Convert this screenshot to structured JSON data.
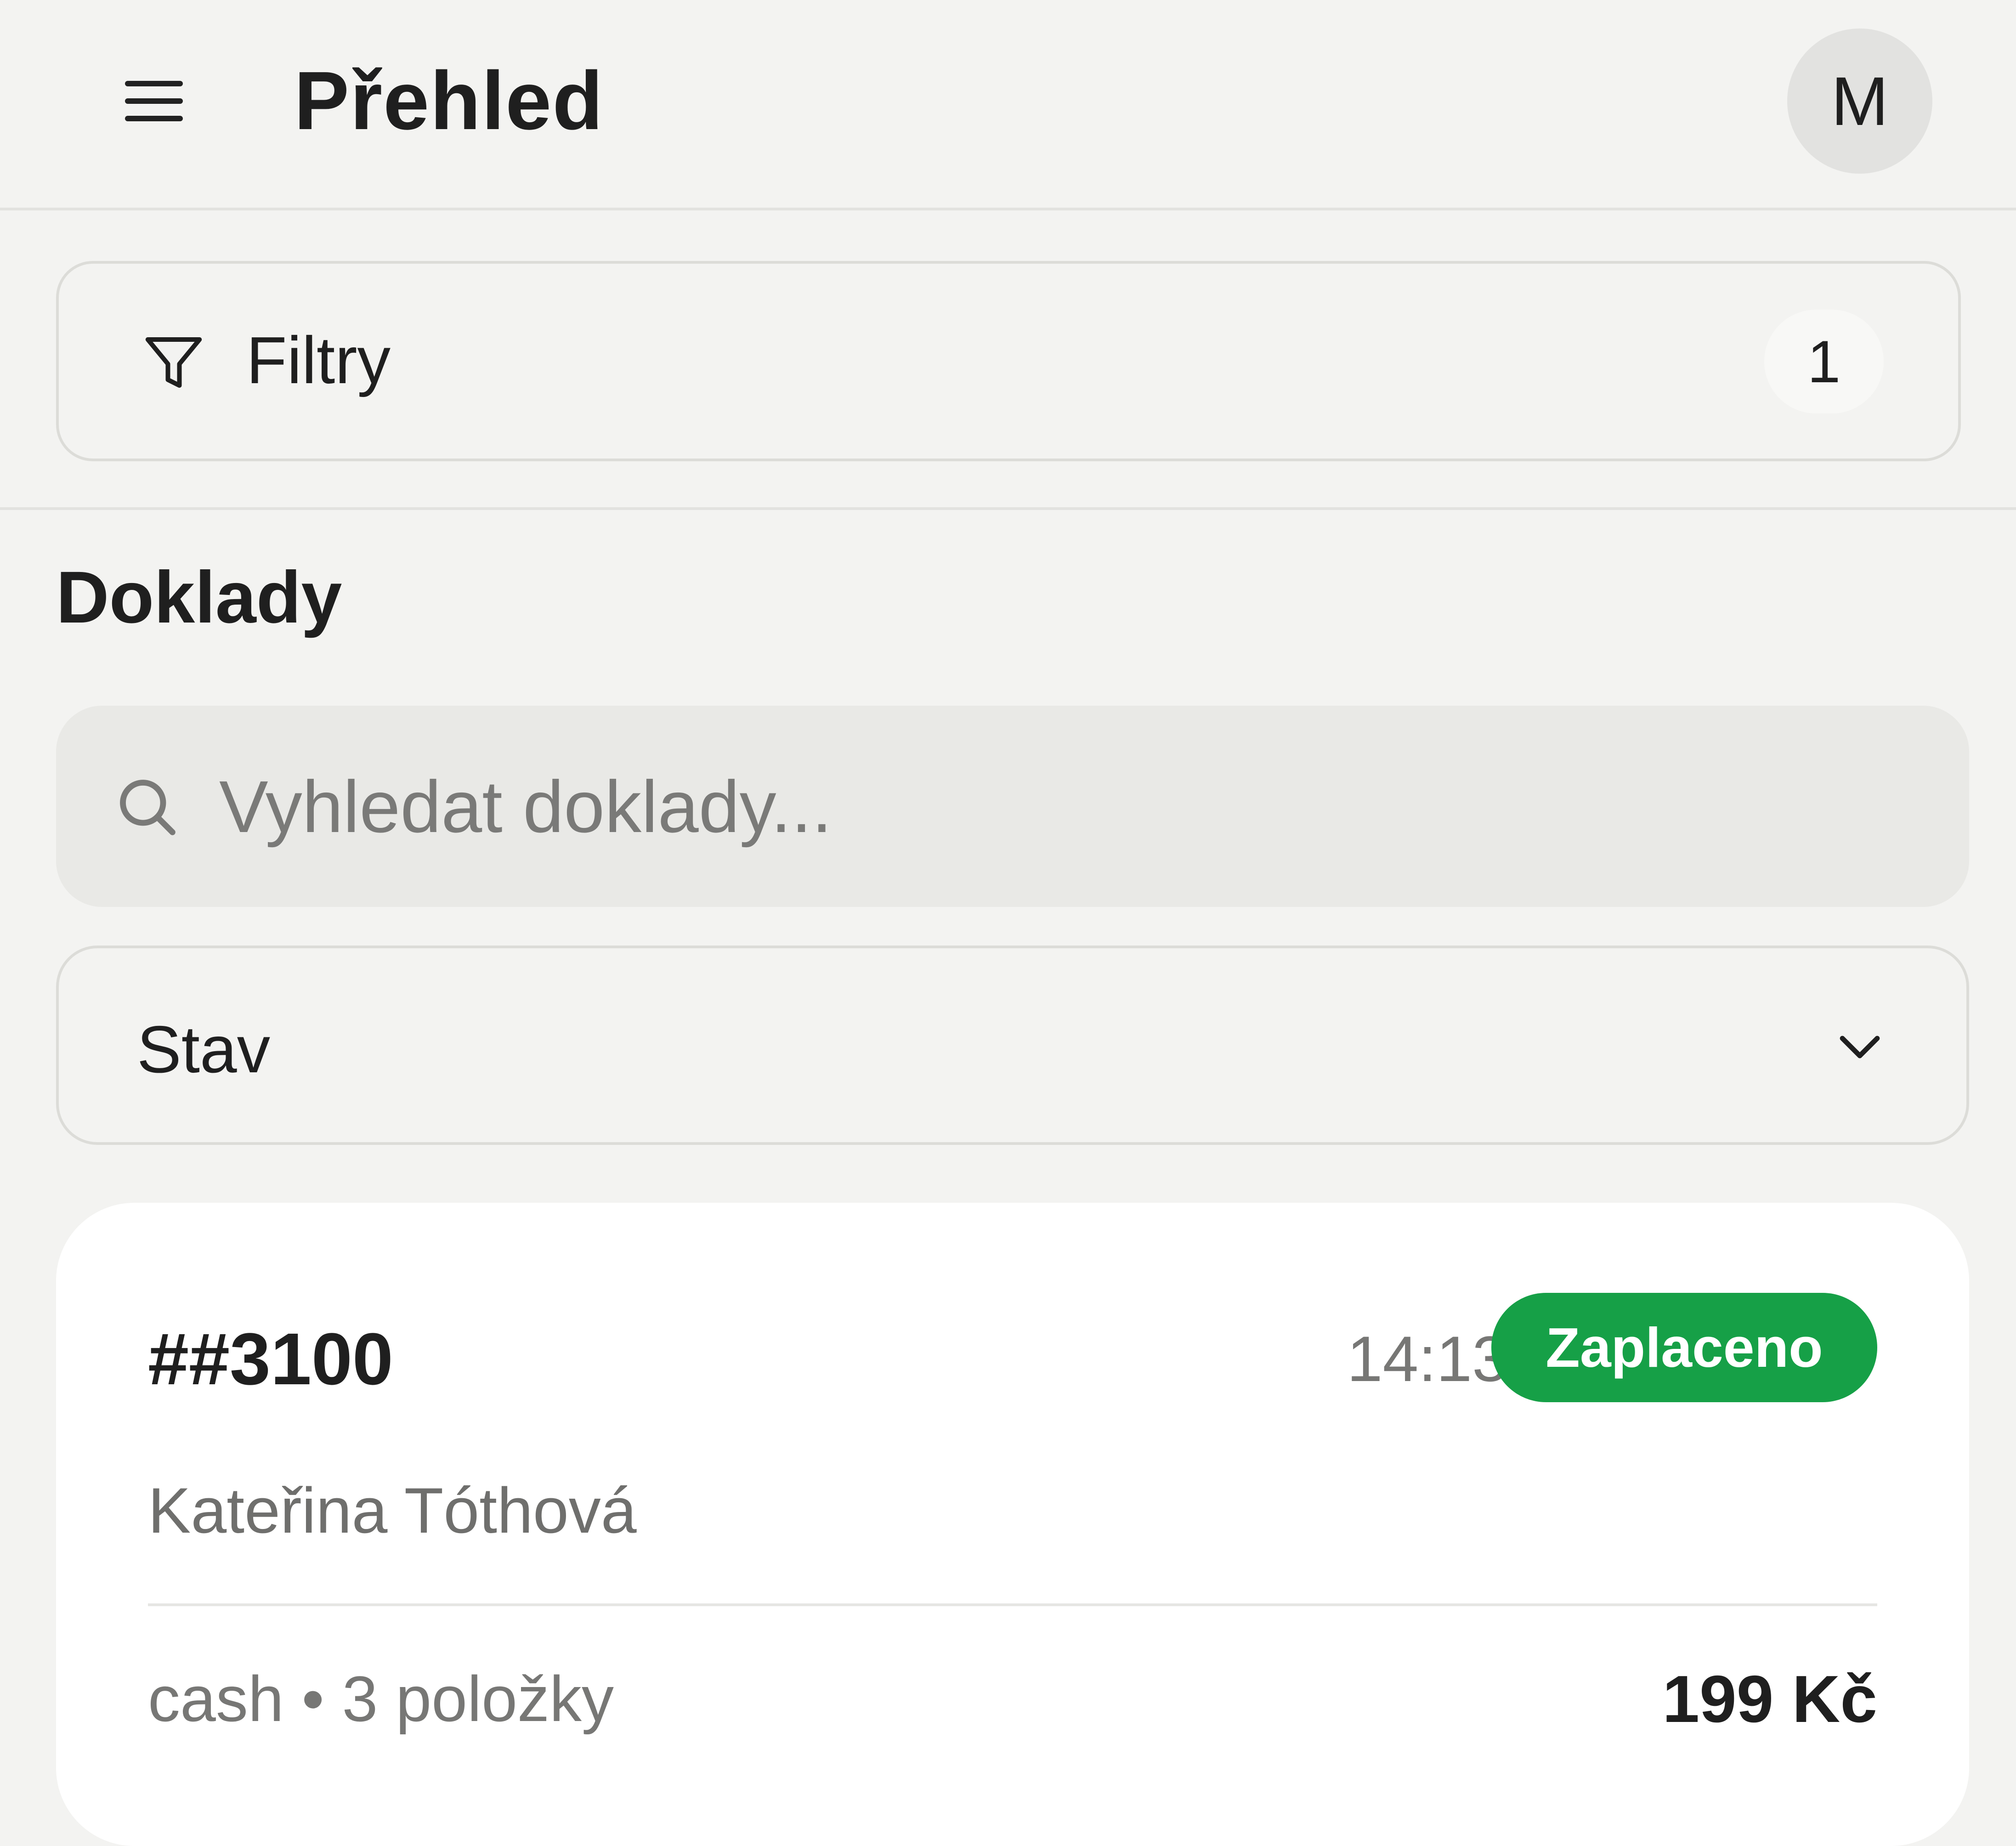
{
  "header": {
    "title": "Přehled",
    "avatar_initial": "M",
    "menu_icon": "hamburger-menu-icon"
  },
  "filters": {
    "label": "Filtry",
    "count": "1",
    "icon": "filter-icon"
  },
  "section": {
    "title": "Doklady"
  },
  "search": {
    "placeholder": "Vyhledat doklady...",
    "value": "",
    "icon": "search-icon"
  },
  "status_select": {
    "selected": "Stav",
    "icon": "chevron-down-icon"
  },
  "documents": [
    {
      "id": "##3100",
      "time": "14:13",
      "status": "Zaplaceno",
      "customer": "Kateřina Tóthová",
      "payment": "cash",
      "separator": "•",
      "items": "3 položky",
      "total": "199 Kč"
    }
  ],
  "colors": {
    "background": "#f3f3f1",
    "status_paid": "#16a047",
    "card": "#ffffff",
    "muted_text": "#777775"
  }
}
